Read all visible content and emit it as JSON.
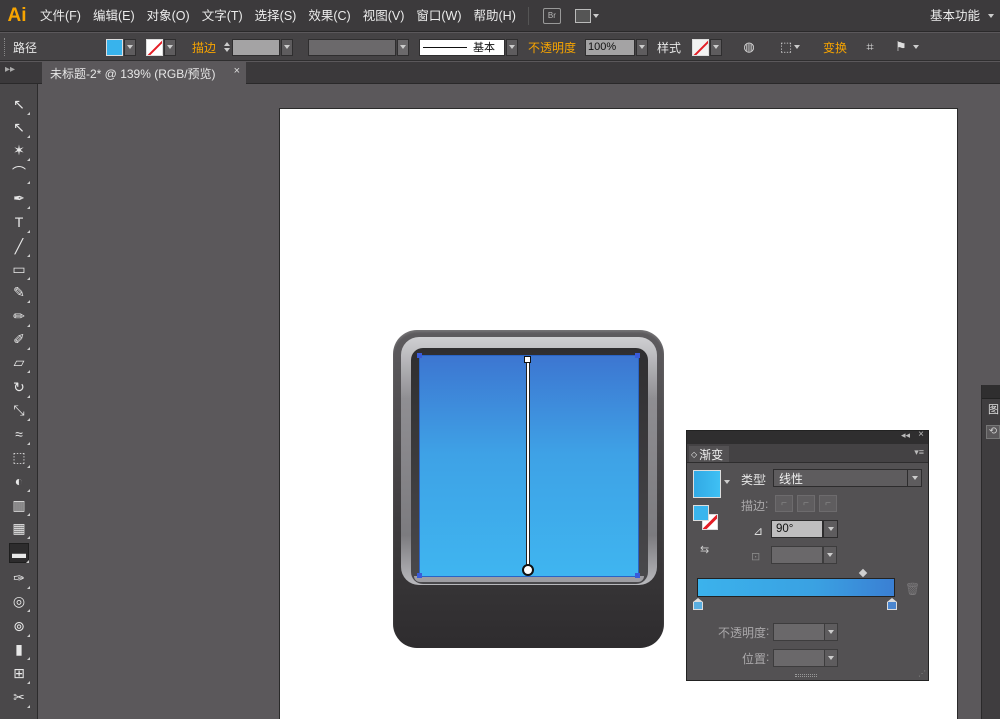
{
  "menubar": {
    "logo": "Ai",
    "items": [
      "文件(F)",
      "编辑(E)",
      "对象(O)",
      "文字(T)",
      "选择(S)",
      "效果(C)",
      "视图(V)",
      "窗口(W)",
      "帮助(H)"
    ],
    "bridge_label": "Br",
    "workspace": "基本功能"
  },
  "controlbar": {
    "selection_type": "路径",
    "stroke_label": "描边",
    "stroke_profile": "基本",
    "opacity_label": "不透明度",
    "opacity_value": "100%",
    "style_label": "样式",
    "transform_label": "变换",
    "fill_color": "#38b3ec"
  },
  "document": {
    "tab_title": "未标题-2* @ 139% (RGB/预览)",
    "close_glyph": "×"
  },
  "toolbar": {
    "tools": [
      {
        "name": "selection-tool",
        "glyph": "↖"
      },
      {
        "name": "direct-selection-tool",
        "glyph": "↖"
      },
      {
        "name": "magic-wand-tool",
        "glyph": "✶"
      },
      {
        "name": "lasso-tool",
        "glyph": "⌒"
      },
      {
        "name": "pen-tool",
        "glyph": "✒"
      },
      {
        "name": "type-tool",
        "glyph": "T"
      },
      {
        "name": "line-segment-tool",
        "glyph": "╱"
      },
      {
        "name": "rectangle-tool",
        "glyph": "▭"
      },
      {
        "name": "paintbrush-tool",
        "glyph": "✎"
      },
      {
        "name": "pencil-tool",
        "glyph": "✏"
      },
      {
        "name": "blob-brush-tool",
        "glyph": "✐"
      },
      {
        "name": "eraser-tool",
        "glyph": "▱"
      },
      {
        "name": "rotate-tool",
        "glyph": "↻"
      },
      {
        "name": "scale-tool",
        "glyph": "⤡"
      },
      {
        "name": "width-tool",
        "glyph": "≈"
      },
      {
        "name": "free-transform-tool",
        "glyph": "⬚"
      },
      {
        "name": "shape-builder-tool",
        "glyph": "◐"
      },
      {
        "name": "perspective-grid-tool",
        "glyph": "▥"
      },
      {
        "name": "mesh-tool",
        "glyph": "▦"
      },
      {
        "name": "gradient-tool",
        "glyph": "▬",
        "active": true
      },
      {
        "name": "eyedropper-tool",
        "glyph": "✑"
      },
      {
        "name": "blend-tool",
        "glyph": "◎"
      },
      {
        "name": "symbol-sprayer-tool",
        "glyph": "⊚"
      },
      {
        "name": "column-graph-tool",
        "glyph": "▮"
      },
      {
        "name": "artboard-tool",
        "glyph": "⊞"
      },
      {
        "name": "slice-tool",
        "glyph": "✂"
      }
    ]
  },
  "gradient_panel": {
    "title": "渐变",
    "type_label": "类型",
    "type_value": "线性",
    "stroke_label": "描边",
    "angle_value": "90°",
    "opacity_label": "不透明度",
    "location_label": "位置",
    "start_color": "#3bb2ec",
    "end_color": "#3a7fd3"
  },
  "edge_panel": {
    "label": "图"
  },
  "canvas": {
    "artboard_color": "#ffffff",
    "screen_gradient_top": "#3d76d1",
    "screen_gradient_bottom": "#3fb5f0"
  }
}
